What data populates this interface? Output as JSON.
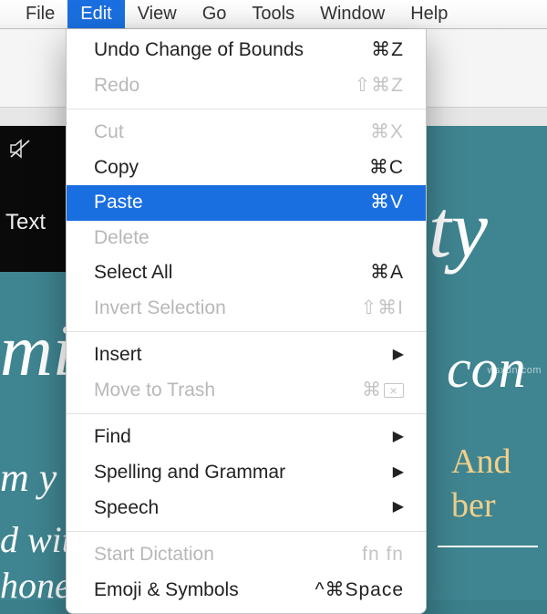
{
  "menubar": {
    "items": [
      {
        "label": "File"
      },
      {
        "label": "Edit",
        "active": true
      },
      {
        "label": "View"
      },
      {
        "label": "Go"
      },
      {
        "label": "Tools"
      },
      {
        "label": "Window"
      },
      {
        "label": "Help"
      }
    ]
  },
  "edit_menu": {
    "groups": [
      [
        {
          "label": "Undo Change of Bounds",
          "shortcut": "⌘Z",
          "enabled": true
        },
        {
          "label": "Redo",
          "shortcut": "⇧⌘Z",
          "enabled": false
        }
      ],
      [
        {
          "label": "Cut",
          "shortcut": "⌘X",
          "enabled": false
        },
        {
          "label": "Copy",
          "shortcut": "⌘C",
          "enabled": true
        },
        {
          "label": "Paste",
          "shortcut": "⌘V",
          "enabled": true,
          "highlighted": true
        },
        {
          "label": "Delete",
          "shortcut": "",
          "enabled": false
        },
        {
          "label": "Select All",
          "shortcut": "⌘A",
          "enabled": true
        },
        {
          "label": "Invert Selection",
          "shortcut": "⇧⌘I",
          "enabled": false
        }
      ],
      [
        {
          "label": "Insert",
          "submenu": true,
          "enabled": true
        },
        {
          "label": "Move to Trash",
          "shortcut": "⌘",
          "del_icon": true,
          "enabled": false
        }
      ],
      [
        {
          "label": "Find",
          "submenu": true,
          "enabled": true
        },
        {
          "label": "Spelling and Grammar",
          "submenu": true,
          "enabled": true
        },
        {
          "label": "Speech",
          "submenu": true,
          "enabled": true
        }
      ],
      [
        {
          "label": "Start Dictation",
          "shortcut": "fn fn",
          "enabled": false
        },
        {
          "label": "Emoji & Symbols",
          "shortcut": "^⌘Space",
          "enabled": true
        }
      ]
    ]
  },
  "background": {
    "text_label": "Text",
    "frag1": "ty",
    "frag2": "mi",
    "frag3": "con",
    "frag4": "m y",
    "frag5": "And",
    "frag6": "ber",
    "frag7": "d with",
    "frag8": "hone &",
    "watermark": "wsxdn.com"
  }
}
